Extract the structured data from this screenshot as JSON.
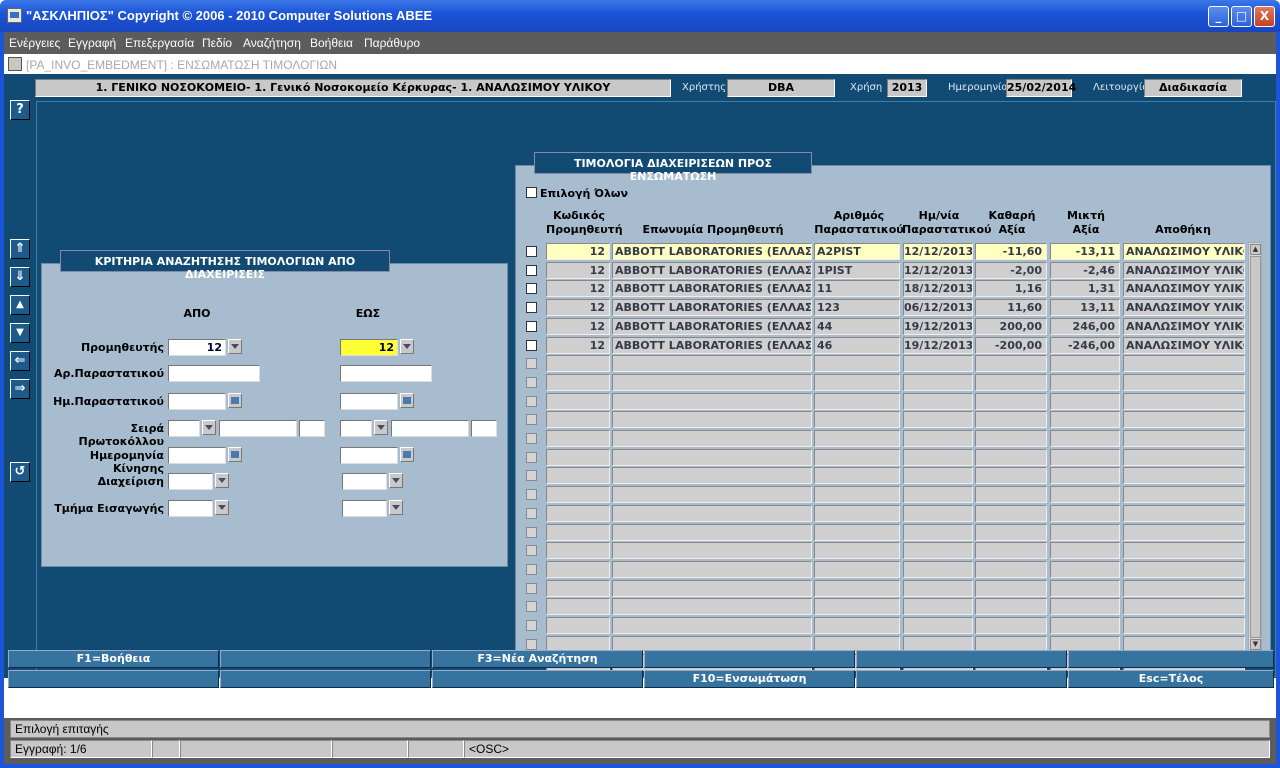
{
  "window": {
    "title": "\"ΑΣΚΛΗΠΙΟΣ\" Copyright © 2006 - 2010 Computer Solutions ABEE",
    "minimize": "_",
    "maximize": "□",
    "close": "X"
  },
  "menu": [
    "Ενέργειες",
    "Εγγραφή",
    "Επεξεργασία",
    "Πεδίο",
    "Αναζήτηση",
    "Βοήθεια",
    "Παράθυρο"
  ],
  "form_title": "[PA_INVO_EMBEDMENT]  :  ΕΝΣΩΜΑΤΩΣΗ ΤΙΜΟΛΟΓΙΩΝ",
  "header": {
    "org": "1. ΓΕΝΙΚΟ ΝΟΣΟΚΟΜΕΙΟ- 1. Γενικό Νοσοκομείο Κέρκυρας- 1. ΑΝΑΛΩΣΙΜΟΥ ΥΛΙΚΟΥ",
    "user_label": "Χρήστης",
    "user": "DBA",
    "year_label": "Χρήση",
    "year": "2013",
    "date_label": "Ημερομηνία",
    "date": "25/02/2014",
    "mode_label": "Λειτουργία",
    "mode": "Διαδικασία"
  },
  "toolbar": {
    "help": "?",
    "first": "⇑",
    "last": "⇓",
    "prev": "▲",
    "next": "▼",
    "left": "⇐",
    "right": "⇒",
    "undo": "↺"
  },
  "criteria": {
    "title": "ΚΡΙΤΗΡΙΑ ΑΝΑΖΗΤΗΣΗΣ ΤΙΜΟΛΟΓΙΩΝ ΑΠΟ ΔΙΑΧΕΙΡΙΣΕΙΣ",
    "from_label": "ΑΠΟ",
    "to_label": "ΕΩΣ",
    "labels": {
      "supplier": "Προμηθευτής",
      "doc_no": "Αρ.Παραστατικού",
      "doc_date": "Ημ.Παραστατικού",
      "protocol": "Σειρά Πρωτοκόλλου",
      "move_date": "Ημερομηνία Κίνησης",
      "management": "Διαχείριση",
      "import_dept": "Τμήμα Εισαγωγής"
    },
    "supplier_from": "12",
    "supplier_to": "12"
  },
  "invoices": {
    "title": "ΤΙΜΟΛΟΓΙΑ ΔΙΑΧΕΙΡΙΣΕΩΝ ΠΡΟΣ ΕΝΣΩΜΑΤΩΣΗ",
    "select_all": "Επιλογή Όλων",
    "columns": {
      "code_1": "Κωδικός",
      "code_2": "Προμηθευτή",
      "name": "Επωνυμία Προμηθευτή",
      "docno_1": "Αριθμός",
      "docno_2": "Παραστατικού",
      "date_1": "Ημ/νία",
      "date_2": "Παραστατικού",
      "net_1": "Καθαρή",
      "net_2": "Αξία",
      "gross_1": "Μικτή",
      "gross_2": "Αξία",
      "store": "Αποθήκη"
    },
    "rows": [
      {
        "code": "12",
        "name": "ABBOTT LABORATORIES (ΕΛΛΑΣ) ΑΒΕ",
        "docno": "A2PIST",
        "date": "12/12/2013",
        "net": "-11,60",
        "gross": "-13,11",
        "store": "ΑΝΑΛΩΣΙΜΟΥ ΥΛΙΚΟΥ"
      },
      {
        "code": "12",
        "name": "ABBOTT LABORATORIES (ΕΛΛΑΣ) ΑΒΕ",
        "docno": "1PIST",
        "date": "12/12/2013",
        "net": "-2,00",
        "gross": "-2,46",
        "store": "ΑΝΑΛΩΣΙΜΟΥ ΥΛΙΚΟΥ"
      },
      {
        "code": "12",
        "name": "ABBOTT LABORATORIES (ΕΛΛΑΣ) ΑΒΕ",
        "docno": "11",
        "date": "18/12/2013",
        "net": "1,16",
        "gross": "1,31",
        "store": "ΑΝΑΛΩΣΙΜΟΥ ΥΛΙΚΟΥ"
      },
      {
        "code": "12",
        "name": "ABBOTT LABORATORIES (ΕΛΛΑΣ) ΑΒΕ",
        "docno": "123",
        "date": "06/12/2013",
        "net": "11,60",
        "gross": "13,11",
        "store": "ΑΝΑΛΩΣΙΜΟΥ ΥΛΙΚΟΥ"
      },
      {
        "code": "12",
        "name": "ABBOTT LABORATORIES (ΕΛΛΑΣ) ΑΒΕ",
        "docno": "44",
        "date": "19/12/2013",
        "net": "200,00",
        "gross": "246,00",
        "store": "ΑΝΑΛΩΣΙΜΟΥ ΥΛΙΚΟΥ"
      },
      {
        "code": "12",
        "name": "ABBOTT LABORATORIES (ΕΛΛΑΣ) ΑΒΕ",
        "docno": "46",
        "date": "19/12/2013",
        "net": "-200,00",
        "gross": "-246,00",
        "store": "ΑΝΑΛΩΣΙΜΟΥ ΥΛΙΚΟΥ"
      }
    ]
  },
  "fkeys": {
    "f1": "F1=Βοήθεια",
    "f3": "F3=Νέα Αναζήτηση",
    "f10": "F10=Ενσωμάτωση",
    "esc": "Esc=Τέλος"
  },
  "status": {
    "message": "Επιλογή επιταγής",
    "record": "Εγγραφή: 1/6",
    "osc": "<OSC>"
  }
}
